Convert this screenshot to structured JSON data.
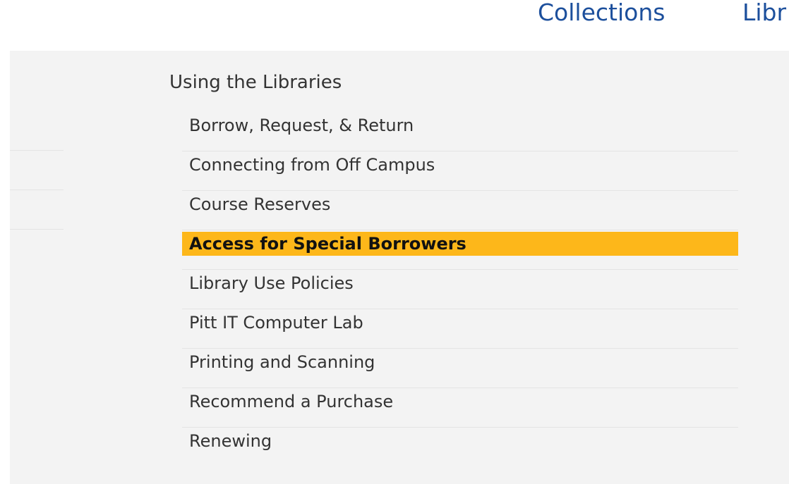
{
  "topnav": {
    "items": [
      {
        "label": "Collections"
      },
      {
        "label": "Libr"
      }
    ]
  },
  "dropdown": {
    "heading": "Using the Libraries",
    "items": [
      {
        "label": "Borrow, Request, & Return",
        "active": false
      },
      {
        "label": "Connecting from Off Campus",
        "active": false
      },
      {
        "label": "Course Reserves",
        "active": false
      },
      {
        "label": "Access for Special Borrowers",
        "active": true
      },
      {
        "label": "Library Use Policies",
        "active": false
      },
      {
        "label": "Pitt IT Computer Lab",
        "active": false
      },
      {
        "label": "Printing and Scanning",
        "active": false
      },
      {
        "label": "Recommend a Purchase",
        "active": false
      },
      {
        "label": "Renewing",
        "active": false
      }
    ],
    "highlight_color": "#fdb71a"
  },
  "colors": {
    "nav_link": "#1c4f9c",
    "panel_bg": "#f3f3f3",
    "text": "#333333"
  }
}
